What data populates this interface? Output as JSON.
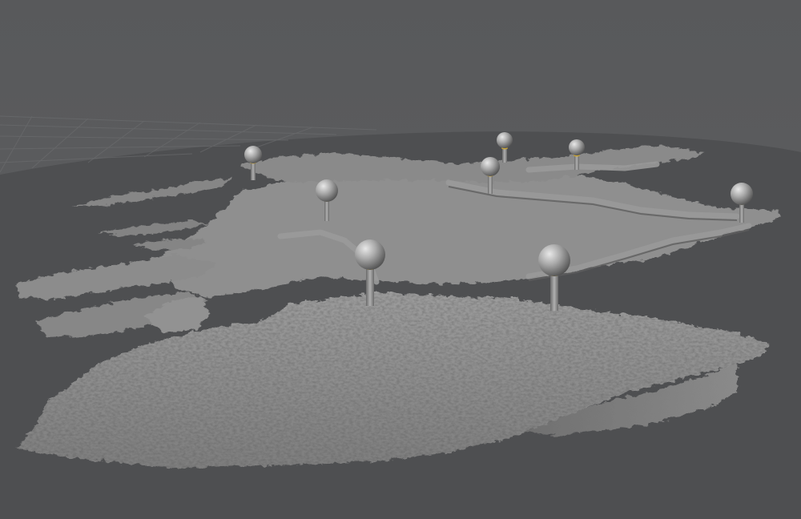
{
  "viewport": {
    "background_top": "#595a5c",
    "background_bottom": "#5e5f61",
    "ground_color": "#4e4f51",
    "grid_color": "#6a6b6d",
    "terrain_light": "#b4b4b4",
    "terrain_mid": "#8e8e8e",
    "terrain_dark": "#5c5c5c",
    "marker_color": "#a6a6a6",
    "marker_ring_color": "#c9a437"
  },
  "scene": {
    "object": "terrain-relief-model",
    "marker_count": 8
  }
}
